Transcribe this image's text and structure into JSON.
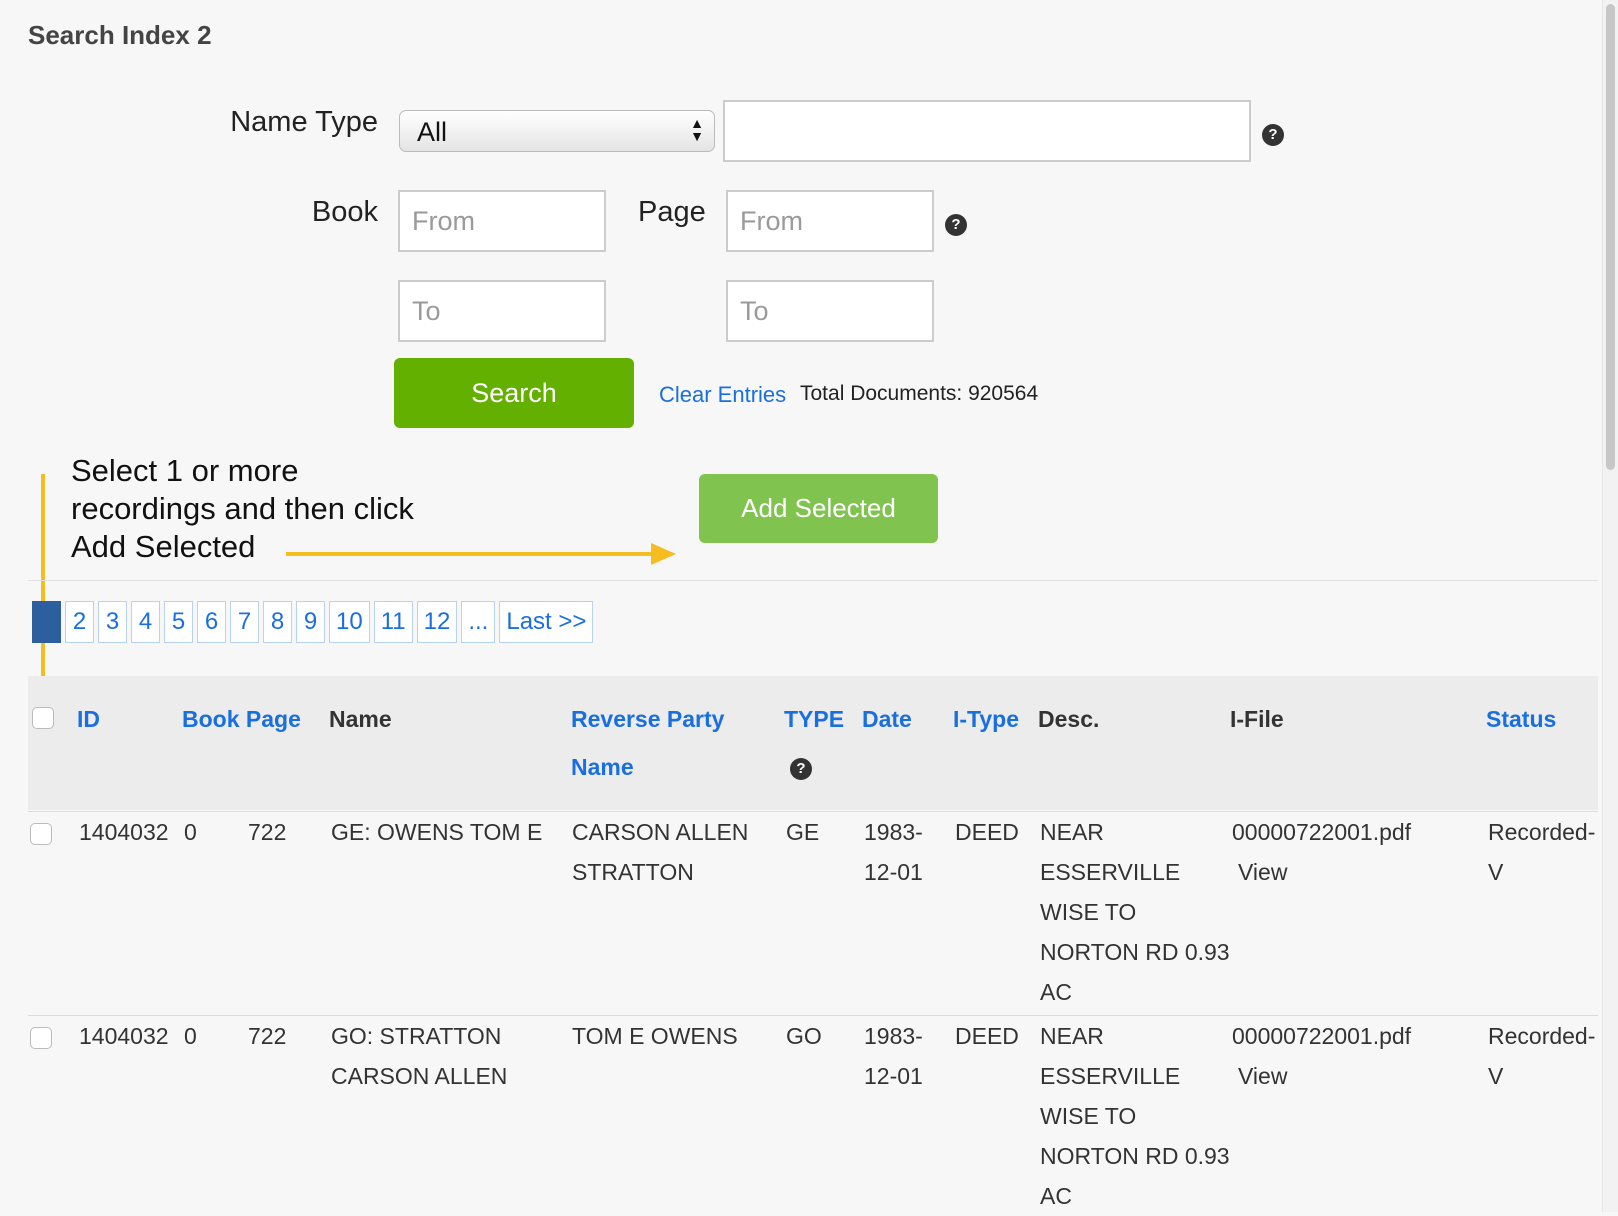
{
  "page": {
    "title": "Search Index 2"
  },
  "search_form": {
    "name_type_label": "Name Type",
    "name_type_selected": "All",
    "name_value": "",
    "book_label": "Book",
    "page_label": "Page",
    "book_from_placeholder": "From",
    "book_to_placeholder": "To",
    "page_from_placeholder": "From",
    "page_to_placeholder": "To",
    "help_glyph": "?",
    "search_button": "Search",
    "clear_entries": "Clear Entries",
    "total_documents": "Total Documents: 920564"
  },
  "annotation": {
    "lines": [
      "Select 1 or more",
      "recordings and then click",
      "Add Selected"
    ],
    "arrow_color": "#f5bd1f"
  },
  "add_selected_button": "Add Selected",
  "pagination": {
    "pages": [
      "1",
      "2",
      "3",
      "4",
      "5",
      "6",
      "7",
      "8",
      "9",
      "10",
      "11",
      "12",
      "...",
      "Last >>"
    ],
    "current": "1"
  },
  "table": {
    "headers": {
      "id": "ID",
      "book_page": "Book Page",
      "name": "Name",
      "reverse_party_1": "Reverse Party",
      "reverse_party_2": "Name",
      "type": "TYPE",
      "date": "Date",
      "i_type": "I-Type",
      "desc": "Desc.",
      "i_file": "I-File",
      "status": "Status"
    },
    "rows": [
      {
        "id": "1404032",
        "book": "0",
        "page": "722",
        "name": [
          "GE: OWENS TOM E"
        ],
        "reverse_party": [
          "CARSON ALLEN",
          "STRATTON"
        ],
        "type": "GE",
        "date": [
          "1983-",
          "12-01"
        ],
        "i_type": "DEED",
        "desc": [
          "NEAR",
          "ESSERVILLE",
          "WISE TO",
          "NORTON RD 0.93",
          "AC"
        ],
        "i_file": "00000722001.pdf",
        "view": "View",
        "status": [
          "Recorded-",
          "V"
        ]
      },
      {
        "id": "1404032",
        "book": "0",
        "page": "722",
        "name": [
          "GO: STRATTON",
          "CARSON ALLEN"
        ],
        "reverse_party": [
          "TOM E OWENS"
        ],
        "type": "GO",
        "date": [
          "1983-",
          "12-01"
        ],
        "i_type": "DEED",
        "desc": [
          "NEAR",
          "ESSERVILLE",
          "WISE TO",
          "NORTON RD 0.93",
          "AC"
        ],
        "i_file": "00000722001.pdf",
        "view": "View",
        "status": [
          "Recorded-",
          "V"
        ]
      }
    ]
  },
  "colors": {
    "search_button": "#63b000",
    "add_button": "#80c34e",
    "link": "#1a6fe0",
    "pager_active": "#2d5f9e",
    "arrow": "#f5bd1f"
  }
}
